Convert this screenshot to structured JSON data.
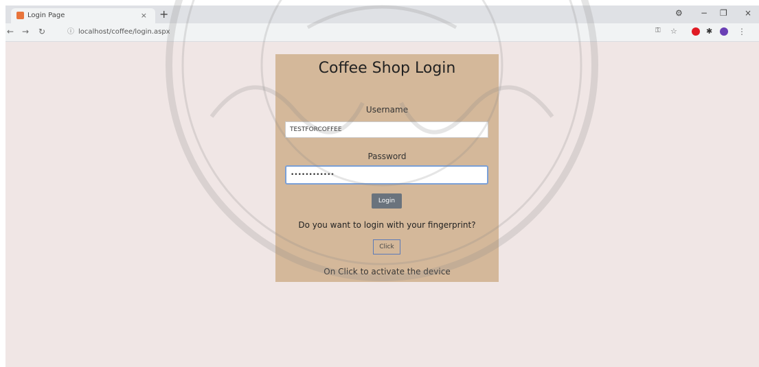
{
  "browser": {
    "tab_title": "Login Page",
    "tab_close": "×",
    "new_tab": "+",
    "url": "localhost/coffee/login.aspx",
    "icons": [
      "back-arrow-icon",
      "forward-arrow-icon",
      "reload-icon",
      "info-icon",
      "key-icon",
      "star-icon",
      "opera-icon",
      "puzzle-icon",
      "profile-icon",
      "menu-icon"
    ],
    "window_controls": {
      "minimize": "−",
      "maximize": "❐",
      "close": "×"
    }
  },
  "login": {
    "title": "Coffee Shop Login",
    "username_label": "Username",
    "username_value": "TESTFORCOFFEE",
    "password_label": "Password",
    "password_value": "••••••••••••",
    "login_button": "Login",
    "fingerprint_question": "Do you want to login with your fingerprint?",
    "click_button": "Click",
    "activate_hint": "On Click to activate the device"
  },
  "colors": {
    "page_bg": "#f0e6e5",
    "card_bg": "#d4b89a",
    "button_bg": "#6a737d",
    "focus_border": "#7a9fd6"
  }
}
